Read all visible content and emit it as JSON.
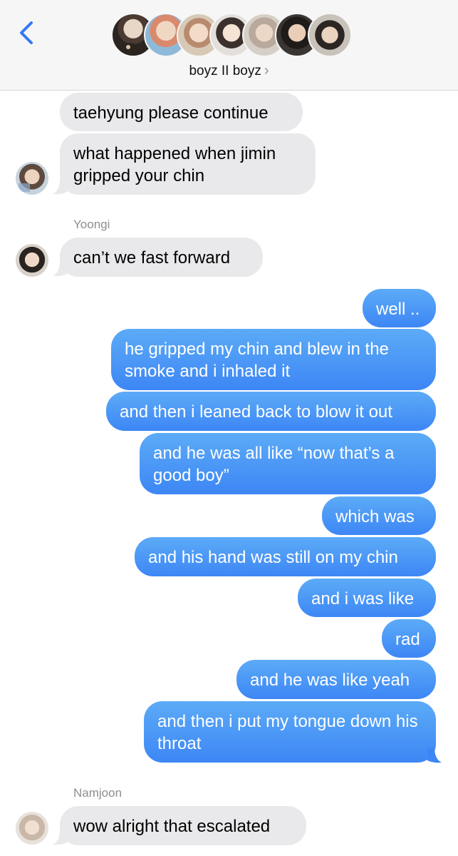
{
  "header": {
    "group_name": "boyz II boyz",
    "chevron": "›",
    "back_icon": "chevron-left-icon",
    "accent_color": "#3478f6"
  },
  "messages": [
    {
      "side": "in",
      "text": "taehyung please continue"
    },
    {
      "side": "in",
      "text": "what happened when jimin gripped your chin"
    },
    {
      "sender": "Yoongi"
    },
    {
      "side": "in",
      "text": "can’t we fast forward"
    },
    {
      "side": "out",
      "text": "well .."
    },
    {
      "side": "out",
      "text": "he gripped my chin and blew in the smoke and i inhaled it"
    },
    {
      "side": "out",
      "text": "and then i leaned back to blow it out"
    },
    {
      "side": "out",
      "text": "and he was all like “now that’s a good boy”"
    },
    {
      "side": "out",
      "text": "which was"
    },
    {
      "side": "out",
      "text": "and his hand was still on my chin"
    },
    {
      "side": "out",
      "text": "and i was like"
    },
    {
      "side": "out",
      "text": "rad"
    },
    {
      "side": "out",
      "text": "and he was like yeah"
    },
    {
      "side": "out",
      "text": "and then i put my tongue down his throat"
    },
    {
      "sender": "Namjoon"
    },
    {
      "side": "in",
      "text": "wow alright that escalated"
    }
  ],
  "colors": {
    "incoming_bubble": "#e9e9eb",
    "outgoing_bubble_top": "#5cabf7",
    "outgoing_bubble_bottom": "#3d86f5",
    "header_bg": "#f6f6f6"
  }
}
